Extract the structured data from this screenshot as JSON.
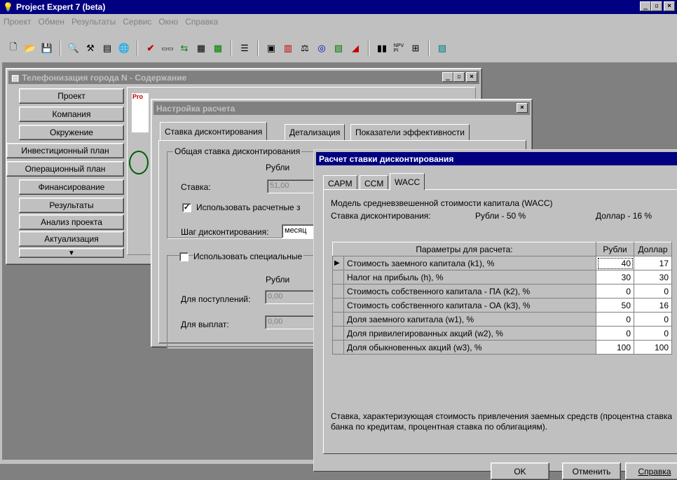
{
  "app": {
    "title": "Project Expert 7 (beta)",
    "menu": [
      "Проект",
      "Обмен",
      "Результаты",
      "Сервис",
      "Окно",
      "Справка"
    ],
    "caption_buttons": [
      "_",
      "▫",
      "×"
    ]
  },
  "content_window": {
    "title": "Телефонизация города N - Содержание",
    "nav": [
      "Проект",
      "Компания",
      "Окружение",
      "Инвестиционный план",
      "Операционный план",
      "Финансирование",
      "Результаты",
      "Анализ проекта",
      "Актуализация"
    ],
    "logo_text": "Pro"
  },
  "settings": {
    "title": "Настройка расчета",
    "tabs": [
      "Ставка дисконтирования",
      "Детализация",
      "Показатели эффективности"
    ],
    "group1_label": "Общая ставка дисконтирования",
    "col_rub": "Рубли",
    "rate_label": "Ставка:",
    "rate_value": "51,00",
    "use_calc_label": "Использовать расчетные з",
    "step_label": "Шаг дисконтирования:",
    "step_value": "месяц",
    "special_label": "Использовать специальные",
    "col_rub2": "Рубли",
    "income_label": "Для поступлений:",
    "income_value": "0,00",
    "payments_label": "Для выплат:",
    "payments_value": "0,00"
  },
  "wacc": {
    "title": "Расчет ставки дисконтирования",
    "tabs": [
      "CAPM",
      "CCM",
      "WACC"
    ],
    "model_label": "Модель средневзвешенной стоимости капитала (WACC)",
    "rate_label": "Ставка дисконтирования:",
    "rate_rub": "Рубли - 50 %",
    "rate_usd": "Доллар - 16 %",
    "grid": {
      "headers": [
        "Параметры для расчета:",
        "Рубли",
        "Доллар"
      ],
      "rows": [
        {
          "name": "Стоимость заемного капитала (k1), %",
          "rub": "40",
          "usd": "17"
        },
        {
          "name": "Налог на прибыль (h), %",
          "rub": "30",
          "usd": "30"
        },
        {
          "name": "Стоимость собственного капитала - ПА (k2), %",
          "rub": "0",
          "usd": "0"
        },
        {
          "name": "Стоимость собственного капитала - ОА (k3), %",
          "rub": "50",
          "usd": "16"
        },
        {
          "name": "Доля заемного капитала (w1), %",
          "rub": "0",
          "usd": "0"
        },
        {
          "name": "Доля привилегированных акций (w2), %",
          "rub": "0",
          "usd": "0"
        },
        {
          "name": "Доля обыкновенных акций (w3), %",
          "rub": "100",
          "usd": "100"
        }
      ]
    },
    "hint": "Ставка, характеризующая стоимость привлечения заемных средств (процентна ставка банка по кредитам, процентная ставка по облигациям).",
    "buttons": {
      "ok": "OK",
      "cancel": "Отменить",
      "help": "Справка"
    }
  }
}
